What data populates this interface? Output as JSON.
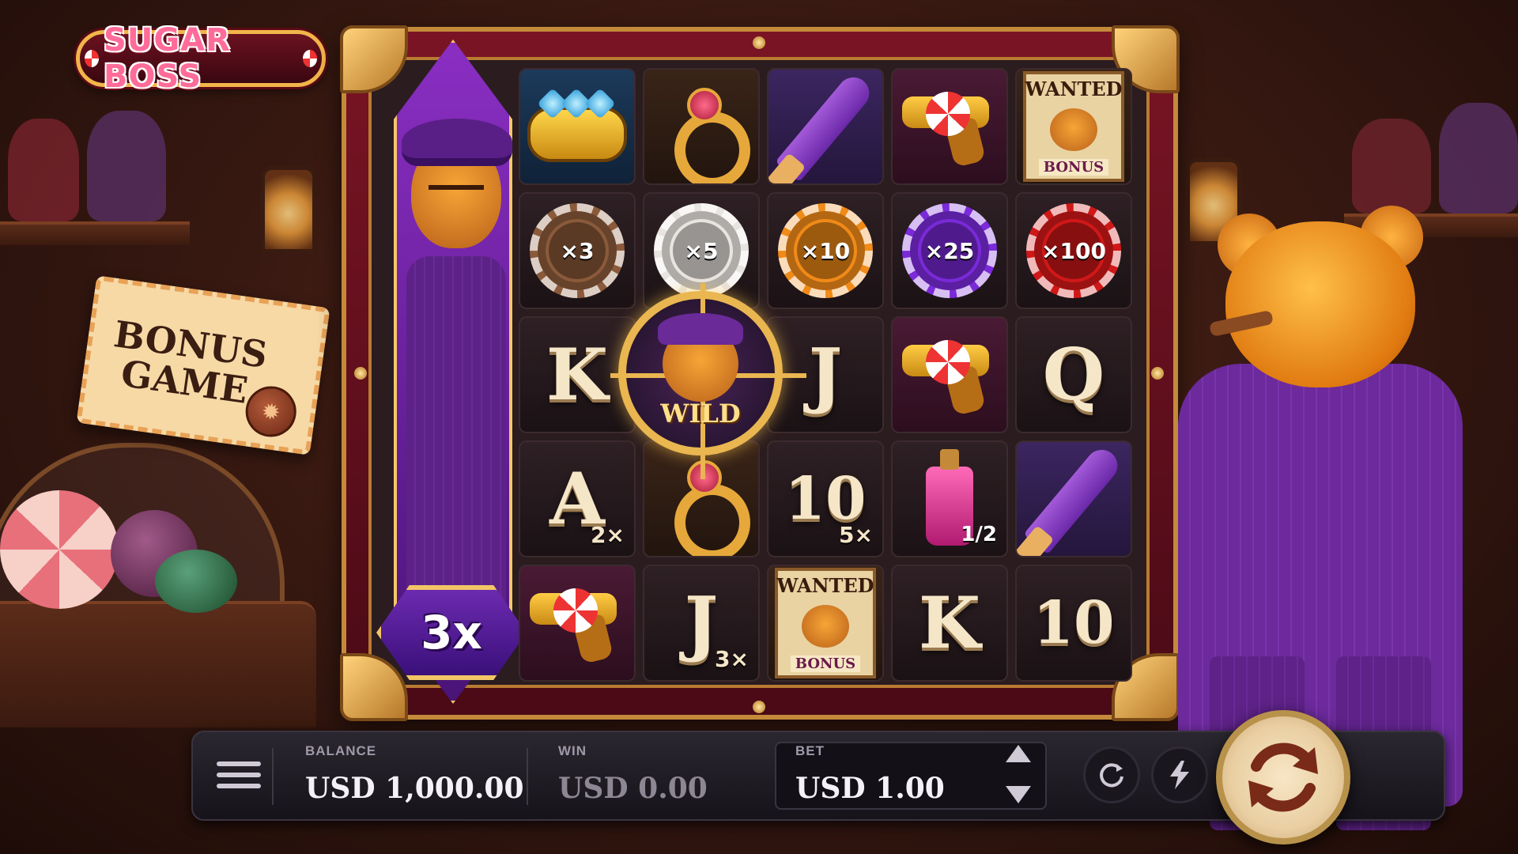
{
  "game": {
    "logo_text": "SUGAR BOSS",
    "bonus_ticket": [
      "BONUS",
      "GAME"
    ],
    "side_multiplier": "3x",
    "wild_label": "WILD"
  },
  "grid": {
    "rows": [
      [
        {
          "type": "icon",
          "icon": "brass-knuckles-icon",
          "bg": "blue"
        },
        {
          "type": "icon",
          "icon": "ring-icon",
          "bg": "brown"
        },
        {
          "type": "icon",
          "icon": "knife-icon",
          "bg": "purple"
        },
        {
          "type": "icon",
          "icon": "candy-gun-icon",
          "bg": "maroon"
        },
        {
          "type": "wanted",
          "icon": "wanted-poster-icon",
          "top": "WANTED",
          "bottom": "BONUS"
        }
      ],
      [
        {
          "type": "chip",
          "label": "×3",
          "color": "#8a5a3a"
        },
        {
          "type": "chip",
          "label": "×5",
          "color": "#e8e4e0"
        },
        {
          "type": "chip",
          "label": "×10",
          "color": "#f08a18"
        },
        {
          "type": "chip",
          "label": "×25",
          "color": "#7a2ad8"
        },
        {
          "type": "chip",
          "label": "×100",
          "color": "#d01818"
        }
      ],
      [
        {
          "type": "letter",
          "label": "K"
        },
        {
          "type": "wild"
        },
        {
          "type": "letter",
          "label": "J"
        },
        {
          "type": "icon",
          "icon": "candy-gun-icon",
          "bg": "maroon"
        },
        {
          "type": "letter",
          "label": "Q"
        }
      ],
      [
        {
          "type": "letter",
          "label": "A",
          "mult": "2×"
        },
        {
          "type": "icon",
          "icon": "ring-icon",
          "bg": "brown"
        },
        {
          "type": "letter",
          "label": "10",
          "mult": "5×"
        },
        {
          "type": "bottle",
          "icon": "potion-bottle-icon",
          "label": "1/2"
        },
        {
          "type": "icon",
          "icon": "knife-icon",
          "bg": "purple"
        }
      ],
      [
        {
          "type": "icon",
          "icon": "candy-gun-icon",
          "bg": "maroon"
        },
        {
          "type": "letter",
          "label": "J",
          "mult": "3×"
        },
        {
          "type": "wanted",
          "icon": "wanted-poster-icon",
          "top": "WANTED",
          "bottom": "BONUS"
        },
        {
          "type": "letter",
          "label": "K"
        },
        {
          "type": "letter",
          "label": "10"
        }
      ]
    ]
  },
  "bar": {
    "balance_label": "BALANCE",
    "balance_value": "USD 1,000.00",
    "win_label": "WIN",
    "win_value": "USD 0.00",
    "bet_label": "BET",
    "bet_value": "USD 1.00"
  },
  "colors": {
    "accent_gold": "#e9b650",
    "frame_red": "#7a1424",
    "suit_purple": "#6c2a9c"
  }
}
